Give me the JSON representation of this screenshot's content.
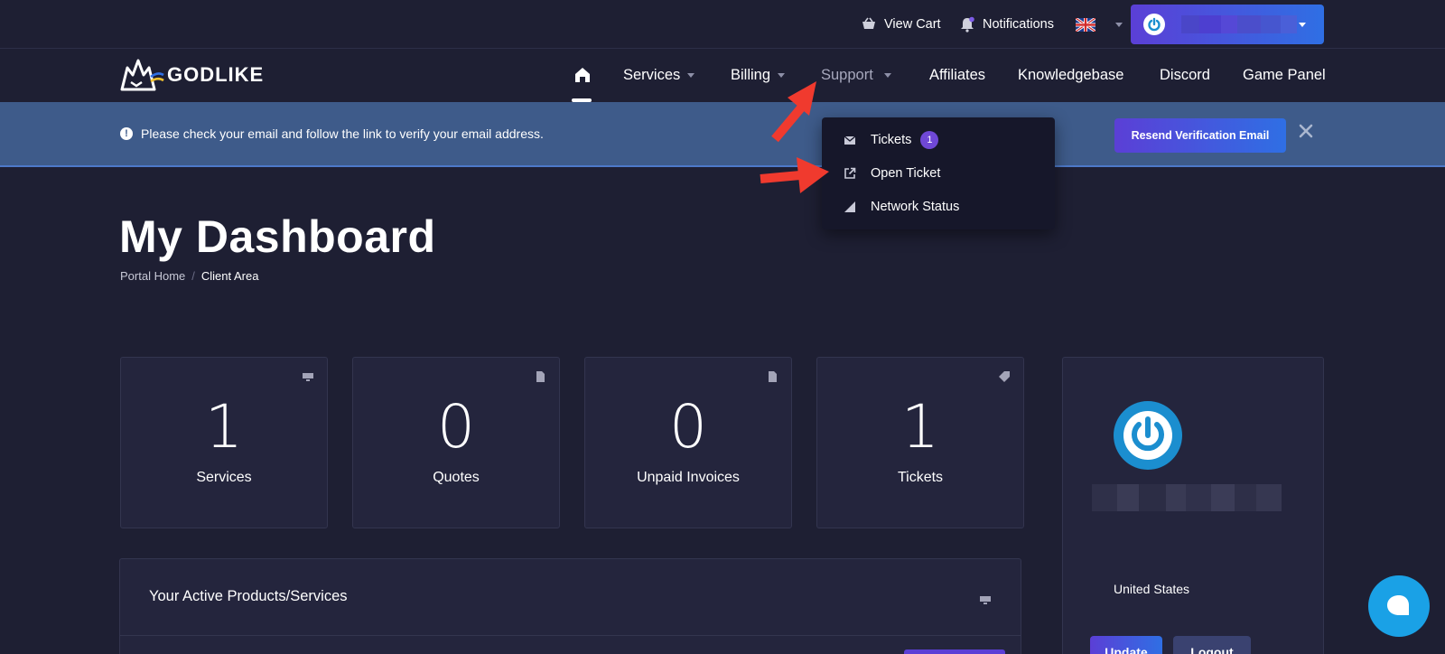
{
  "topbar": {
    "cart_label": "View Cart",
    "notifications_label": "Notifications",
    "language_icon": "uk-flag-icon"
  },
  "nav": {
    "brand": "GODLIKE",
    "items": [
      {
        "label": "Services",
        "has_dropdown": true
      },
      {
        "label": "Billing",
        "has_dropdown": true
      },
      {
        "label": "Support",
        "has_dropdown": true
      },
      {
        "label": "Affiliates"
      },
      {
        "label": "Knowledgebase"
      },
      {
        "label": "Discord"
      },
      {
        "label": "Game Panel"
      }
    ]
  },
  "support_menu": {
    "items": [
      {
        "label": "Tickets",
        "badge": "1",
        "icon": "envelope-icon"
      },
      {
        "label": "Open Ticket",
        "icon": "external-link-icon"
      },
      {
        "label": "Network Status",
        "icon": "signal-icon"
      }
    ]
  },
  "alert": {
    "message": "Please check your email and follow the link to verify your email address.",
    "button_label": "Resend Verification Email"
  },
  "page": {
    "title": "My Dashboard",
    "breadcrumb": [
      "Portal Home",
      "Client Area"
    ]
  },
  "stats": [
    {
      "value": "1",
      "label": "Services",
      "icon": "server-icon"
    },
    {
      "value": "0",
      "label": "Quotes",
      "icon": "document-icon"
    },
    {
      "value": "0",
      "label": "Unpaid Invoices",
      "icon": "document-icon"
    },
    {
      "value": "1",
      "label": "Tickets",
      "icon": "tag-icon"
    }
  ],
  "profile": {
    "country": "United States",
    "update_label": "Update",
    "logout_label": "Logout"
  },
  "products": {
    "title": "Your Active Products/Services"
  },
  "colors": {
    "background": "#1e1f33",
    "panel": "#24253d",
    "alert": "#3e5b8a",
    "accent_start": "#5b3fd6",
    "accent_end": "#2f6fe4",
    "chat": "#1aa1e6",
    "annotation_arrow": "#f03a2e"
  }
}
